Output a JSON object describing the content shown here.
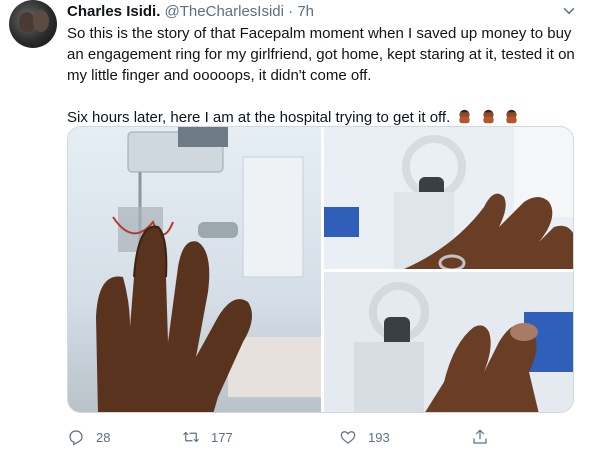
{
  "author": {
    "name": "Charles Isidi.",
    "handle": "@TheCharlesIsidi",
    "separator": "·",
    "time": "7h"
  },
  "tweet": {
    "paragraph1": "So this is the story of that Facepalm moment when I saved up money to buy an engagement ring for my girlfriend, got home, kept staring at it, tested it on my little finger and ooooops, it didn't come off.",
    "paragraph2": "Six hours later, here I am at the hospital trying to get it off."
  },
  "media": {
    "photo_left": "hand-hospital-photo",
    "photo_top_right": "ring-finger-photo",
    "photo_bottom_right": "finger-closeup-photo"
  },
  "actions": {
    "reply_count": "28",
    "retweet_count": "177",
    "like_count": "193"
  },
  "colors": {
    "text": "#0f1419",
    "muted": "#5b7083",
    "border": "#cfd9de",
    "skin": "#6b3f25"
  },
  "icons": [
    "chevron-down-icon",
    "facepalm-emoji-icon",
    "reply-icon",
    "retweet-icon",
    "like-icon",
    "share-icon"
  ]
}
